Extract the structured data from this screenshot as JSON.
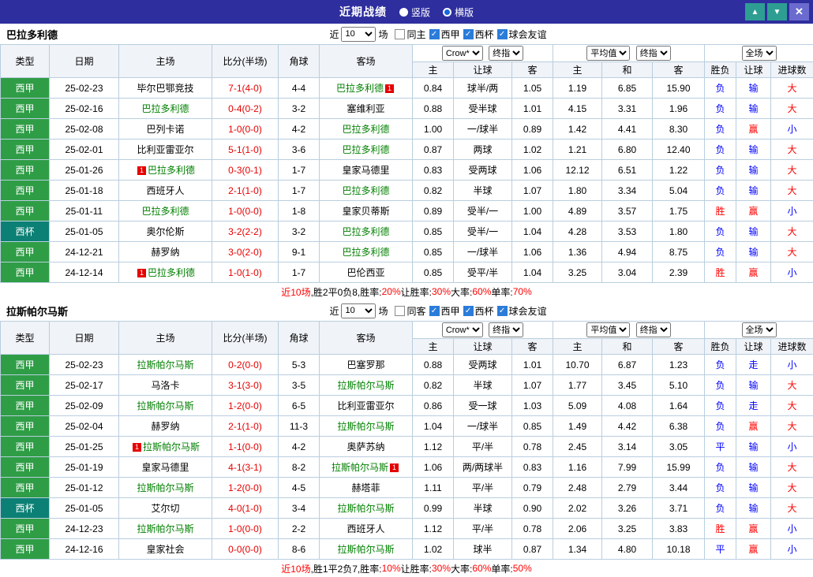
{
  "titlebar": {
    "title": "近期战绩",
    "radios": [
      {
        "label": "竖版",
        "selected": false
      },
      {
        "label": "横版",
        "selected": true
      }
    ],
    "buttons": {
      "up": "▲",
      "down": "▼",
      "close": "✕"
    }
  },
  "filter_labels": {
    "near": "近",
    "count": "10",
    "games": "场"
  },
  "header_labels": {
    "type": "类型",
    "date": "日期",
    "home": "主场",
    "score": "比分(半场)",
    "corner": "角球",
    "away": "客场",
    "asia_home": "主",
    "asia_hcp": "让球",
    "asia_away": "客",
    "euro_home": "主",
    "euro_draw": "和",
    "euro_away": "客",
    "result": "胜负",
    "hcp_result": "让球",
    "goals": "进球数",
    "dd_crown": "Crow*",
    "dd_final": "终指",
    "dd_avg": "平均值",
    "dd_full": "全场"
  },
  "colors": {
    "titlebar_bg": "#2e2e9e",
    "liga_green": "#2f9d46",
    "cup_teal": "#0c8074",
    "team_green": "#008000",
    "win_red": "#ff0000",
    "loss_blue": "#0000ff"
  },
  "sections": [
    {
      "team": "巴拉多利德",
      "filters": [
        {
          "label": "同主",
          "checked": false
        },
        {
          "label": "西甲",
          "checked": true
        },
        {
          "label": "西杯",
          "checked": true
        },
        {
          "label": "球会友谊",
          "checked": true
        }
      ],
      "rows": [
        {
          "league": "西甲",
          "cup": false,
          "date": "25-02-23",
          "home": "毕尔巴鄂竞技",
          "home_focus": false,
          "home_badge": "",
          "score": "7-1",
          "half": "(4-0)",
          "corner": "4-4",
          "away": "巴拉多利德",
          "away_focus": true,
          "away_badge": "1",
          "asia": [
            "0.84",
            "球半/两",
            "1.05"
          ],
          "euro": [
            "1.19",
            "6.85",
            "15.90"
          ],
          "result": [
            "负",
            "输",
            "大"
          ]
        },
        {
          "league": "西甲",
          "cup": false,
          "date": "25-02-16",
          "home": "巴拉多利德",
          "home_focus": true,
          "home_badge": "",
          "score": "0-4",
          "half": "(0-2)",
          "corner": "3-2",
          "away": "塞维利亚",
          "away_focus": false,
          "away_badge": "",
          "asia": [
            "0.88",
            "受半球",
            "1.01"
          ],
          "euro": [
            "4.15",
            "3.31",
            "1.96"
          ],
          "result": [
            "负",
            "输",
            "大"
          ]
        },
        {
          "league": "西甲",
          "cup": false,
          "date": "25-02-08",
          "home": "巴列卡诺",
          "home_focus": false,
          "home_badge": "",
          "score": "1-0",
          "half": "(0-0)",
          "corner": "4-2",
          "away": "巴拉多利德",
          "away_focus": true,
          "away_badge": "",
          "asia": [
            "1.00",
            "一/球半",
            "0.89"
          ],
          "euro": [
            "1.42",
            "4.41",
            "8.30"
          ],
          "result": [
            "负",
            "赢",
            "小"
          ]
        },
        {
          "league": "西甲",
          "cup": false,
          "date": "25-02-01",
          "home": "比利亚雷亚尔",
          "home_focus": false,
          "home_badge": "",
          "score": "5-1",
          "half": "(1-0)",
          "corner": "3-6",
          "away": "巴拉多利德",
          "away_focus": true,
          "away_badge": "",
          "asia": [
            "0.87",
            "两球",
            "1.02"
          ],
          "euro": [
            "1.21",
            "6.80",
            "12.40"
          ],
          "result": [
            "负",
            "输",
            "大"
          ]
        },
        {
          "league": "西甲",
          "cup": false,
          "date": "25-01-26",
          "home": "巴拉多利德",
          "home_focus": true,
          "home_badge": "1",
          "score": "0-3",
          "half": "(0-1)",
          "corner": "1-7",
          "away": "皇家马德里",
          "away_focus": false,
          "away_badge": "",
          "asia": [
            "0.83",
            "受两球",
            "1.06"
          ],
          "euro": [
            "12.12",
            "6.51",
            "1.22"
          ],
          "result": [
            "负",
            "输",
            "大"
          ]
        },
        {
          "league": "西甲",
          "cup": false,
          "date": "25-01-18",
          "home": "西班牙人",
          "home_focus": false,
          "home_badge": "",
          "score": "2-1",
          "half": "(1-0)",
          "corner": "1-7",
          "away": "巴拉多利德",
          "away_focus": true,
          "away_badge": "",
          "asia": [
            "0.82",
            "半球",
            "1.07"
          ],
          "euro": [
            "1.80",
            "3.34",
            "5.04"
          ],
          "result": [
            "负",
            "输",
            "大"
          ]
        },
        {
          "league": "西甲",
          "cup": false,
          "date": "25-01-11",
          "home": "巴拉多利德",
          "home_focus": true,
          "home_badge": "",
          "score": "1-0",
          "half": "(0-0)",
          "corner": "1-8",
          "away": "皇家贝蒂斯",
          "away_focus": false,
          "away_badge": "",
          "asia": [
            "0.89",
            "受半/一",
            "1.00"
          ],
          "euro": [
            "4.89",
            "3.57",
            "1.75"
          ],
          "result": [
            "胜",
            "赢",
            "小"
          ]
        },
        {
          "league": "西杯",
          "cup": true,
          "date": "25-01-05",
          "home": "奥尔伦斯",
          "home_focus": false,
          "home_badge": "",
          "score": "3-2",
          "half": "(2-2)",
          "corner": "3-2",
          "away": "巴拉多利德",
          "away_focus": true,
          "away_badge": "",
          "asia": [
            "0.85",
            "受半/一",
            "1.04"
          ],
          "euro": [
            "4.28",
            "3.53",
            "1.80"
          ],
          "result": [
            "负",
            "输",
            "大"
          ]
        },
        {
          "league": "西甲",
          "cup": false,
          "date": "24-12-21",
          "home": "赫罗纳",
          "home_focus": false,
          "home_badge": "",
          "score": "3-0",
          "half": "(2-0)",
          "corner": "9-1",
          "away": "巴拉多利德",
          "away_focus": true,
          "away_badge": "",
          "asia": [
            "0.85",
            "一/球半",
            "1.06"
          ],
          "euro": [
            "1.36",
            "4.94",
            "8.75"
          ],
          "result": [
            "负",
            "输",
            "大"
          ]
        },
        {
          "league": "西甲",
          "cup": false,
          "date": "24-12-14",
          "home": "巴拉多利德",
          "home_focus": true,
          "home_badge": "1",
          "score": "1-0",
          "half": "(1-0)",
          "corner": "1-7",
          "away": "巴伦西亚",
          "away_focus": false,
          "away_badge": "",
          "asia": [
            "0.85",
            "受平/半",
            "1.04"
          ],
          "euro": [
            "3.25",
            "3.04",
            "2.39"
          ],
          "result": [
            "胜",
            "赢",
            "小"
          ]
        }
      ],
      "summary": [
        {
          "text": "近10场",
          "red": true
        },
        {
          "text": ",胜2平0负8, ",
          "red": false
        },
        {
          "text": "胜率:",
          "red": false
        },
        {
          "text": "20%",
          "red": true
        },
        {
          "text": " 让胜率:",
          "red": false
        },
        {
          "text": "30%",
          "red": true
        },
        {
          "text": " 大率:",
          "red": false
        },
        {
          "text": "60%",
          "red": true
        },
        {
          "text": " 单率:",
          "red": false
        },
        {
          "text": "70%",
          "red": true
        }
      ]
    },
    {
      "team": "拉斯帕尔马斯",
      "filters": [
        {
          "label": "同客",
          "checked": false
        },
        {
          "label": "西甲",
          "checked": true
        },
        {
          "label": "西杯",
          "checked": true
        },
        {
          "label": "球会友谊",
          "checked": true
        }
      ],
      "rows": [
        {
          "league": "西甲",
          "cup": false,
          "date": "25-02-23",
          "home": "拉斯帕尔马斯",
          "home_focus": true,
          "home_badge": "",
          "score": "0-2",
          "half": "(0-0)",
          "corner": "5-3",
          "away": "巴塞罗那",
          "away_focus": false,
          "away_badge": "",
          "asia": [
            "0.88",
            "受两球",
            "1.01"
          ],
          "euro": [
            "10.70",
            "6.87",
            "1.23"
          ],
          "result": [
            "负",
            "走",
            "小"
          ]
        },
        {
          "league": "西甲",
          "cup": false,
          "date": "25-02-17",
          "home": "马洛卡",
          "home_focus": false,
          "home_badge": "",
          "score": "3-1",
          "half": "(3-0)",
          "corner": "3-5",
          "away": "拉斯帕尔马斯",
          "away_focus": true,
          "away_badge": "",
          "asia": [
            "0.82",
            "半球",
            "1.07"
          ],
          "euro": [
            "1.77",
            "3.45",
            "5.10"
          ],
          "result": [
            "负",
            "输",
            "大"
          ]
        },
        {
          "league": "西甲",
          "cup": false,
          "date": "25-02-09",
          "home": "拉斯帕尔马斯",
          "home_focus": true,
          "home_badge": "",
          "score": "1-2",
          "half": "(0-0)",
          "corner": "6-5",
          "away": "比利亚雷亚尔",
          "away_focus": false,
          "away_badge": "",
          "asia": [
            "0.86",
            "受一球",
            "1.03"
          ],
          "euro": [
            "5.09",
            "4.08",
            "1.64"
          ],
          "result": [
            "负",
            "走",
            "大"
          ]
        },
        {
          "league": "西甲",
          "cup": false,
          "date": "25-02-04",
          "home": "赫罗纳",
          "home_focus": false,
          "home_badge": "",
          "score": "2-1",
          "half": "(1-0)",
          "corner": "11-3",
          "away": "拉斯帕尔马斯",
          "away_focus": true,
          "away_badge": "",
          "asia": [
            "1.04",
            "一/球半",
            "0.85"
          ],
          "euro": [
            "1.49",
            "4.42",
            "6.38"
          ],
          "result": [
            "负",
            "赢",
            "大"
          ]
        },
        {
          "league": "西甲",
          "cup": false,
          "date": "25-01-25",
          "home": "拉斯帕尔马斯",
          "home_focus": true,
          "home_badge": "1",
          "score": "1-1",
          "half": "(0-0)",
          "corner": "4-2",
          "away": "奥萨苏纳",
          "away_focus": false,
          "away_badge": "",
          "asia": [
            "1.12",
            "平/半",
            "0.78"
          ],
          "euro": [
            "2.45",
            "3.14",
            "3.05"
          ],
          "result": [
            "平",
            "输",
            "小"
          ]
        },
        {
          "league": "西甲",
          "cup": false,
          "date": "25-01-19",
          "home": "皇家马德里",
          "home_focus": false,
          "home_badge": "",
          "score": "4-1",
          "half": "(3-1)",
          "corner": "8-2",
          "away": "拉斯帕尔马斯",
          "away_focus": true,
          "away_badge": "1",
          "asia": [
            "1.06",
            "两/两球半",
            "0.83"
          ],
          "euro": [
            "1.16",
            "7.99",
            "15.99"
          ],
          "result": [
            "负",
            "输",
            "大"
          ]
        },
        {
          "league": "西甲",
          "cup": false,
          "date": "25-01-12",
          "home": "拉斯帕尔马斯",
          "home_focus": true,
          "home_badge": "",
          "score": "1-2",
          "half": "(0-0)",
          "corner": "4-5",
          "away": "赫塔菲",
          "away_focus": false,
          "away_badge": "",
          "asia": [
            "1.11",
            "平/半",
            "0.79"
          ],
          "euro": [
            "2.48",
            "2.79",
            "3.44"
          ],
          "result": [
            "负",
            "输",
            "大"
          ]
        },
        {
          "league": "西杯",
          "cup": true,
          "date": "25-01-05",
          "home": "艾尔切",
          "home_focus": false,
          "home_badge": "",
          "score": "4-0",
          "half": "(1-0)",
          "corner": "3-4",
          "away": "拉斯帕尔马斯",
          "away_focus": true,
          "away_badge": "",
          "asia": [
            "0.99",
            "半球",
            "0.90"
          ],
          "euro": [
            "2.02",
            "3.26",
            "3.71"
          ],
          "result": [
            "负",
            "输",
            "大"
          ]
        },
        {
          "league": "西甲",
          "cup": false,
          "date": "24-12-23",
          "home": "拉斯帕尔马斯",
          "home_focus": true,
          "home_badge": "",
          "score": "1-0",
          "half": "(0-0)",
          "corner": "2-2",
          "away": "西班牙人",
          "away_focus": false,
          "away_badge": "",
          "asia": [
            "1.12",
            "平/半",
            "0.78"
          ],
          "euro": [
            "2.06",
            "3.25",
            "3.83"
          ],
          "result": [
            "胜",
            "赢",
            "小"
          ]
        },
        {
          "league": "西甲",
          "cup": false,
          "date": "24-12-16",
          "home": "皇家社会",
          "home_focus": false,
          "home_badge": "",
          "score": "0-0",
          "half": "(0-0)",
          "corner": "8-6",
          "away": "拉斯帕尔马斯",
          "away_focus": true,
          "away_badge": "",
          "asia": [
            "1.02",
            "球半",
            "0.87"
          ],
          "euro": [
            "1.34",
            "4.80",
            "10.18"
          ],
          "result": [
            "平",
            "赢",
            "小"
          ]
        }
      ],
      "summary": [
        {
          "text": "近10场",
          "red": true
        },
        {
          "text": ",胜1平2负7, ",
          "red": false
        },
        {
          "text": "胜率:",
          "red": false
        },
        {
          "text": "10%",
          "red": true
        },
        {
          "text": " 让胜率:",
          "red": false
        },
        {
          "text": "30%",
          "red": true
        },
        {
          "text": " 大率:",
          "red": false
        },
        {
          "text": "60%",
          "red": true
        },
        {
          "text": " 单率:",
          "red": false
        },
        {
          "text": "50%",
          "red": true
        }
      ]
    }
  ]
}
